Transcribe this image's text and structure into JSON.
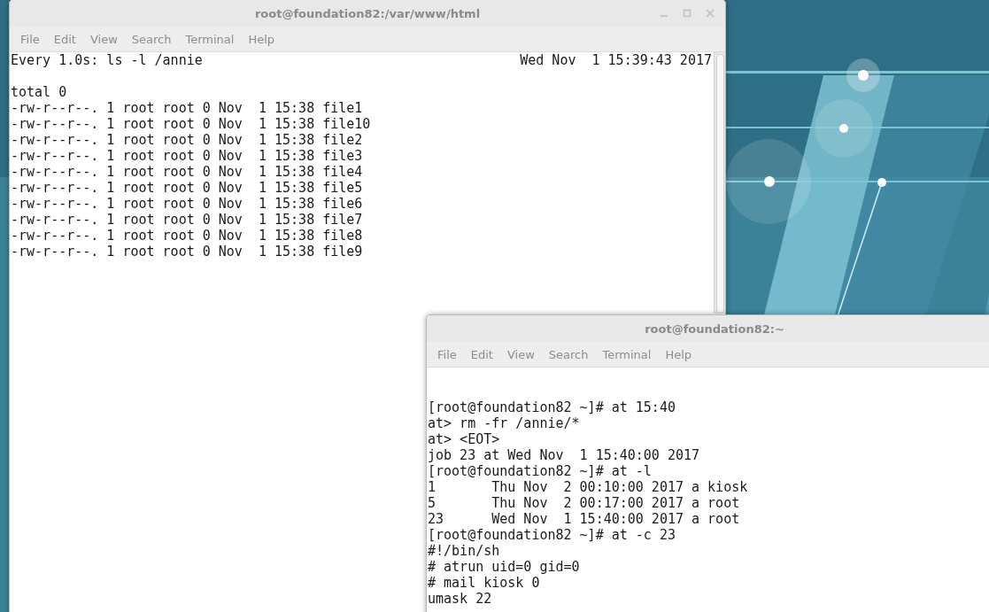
{
  "windows": [
    {
      "title": "root@foundation82:/var/www/html",
      "menu": [
        "File",
        "Edit",
        "View",
        "Search",
        "Terminal",
        "Help"
      ],
      "header": {
        "command": "Every 1.0s: ls -l /annie",
        "timestamp": "Wed Nov  1 15:39:43 2017"
      },
      "lines": [
        "total 0",
        "-rw-r--r--. 1 root root 0 Nov  1 15:38 file1",
        "-rw-r--r--. 1 root root 0 Nov  1 15:38 file10",
        "-rw-r--r--. 1 root root 0 Nov  1 15:38 file2",
        "-rw-r--r--. 1 root root 0 Nov  1 15:38 file3",
        "-rw-r--r--. 1 root root 0 Nov  1 15:38 file4",
        "-rw-r--r--. 1 root root 0 Nov  1 15:38 file5",
        "-rw-r--r--. 1 root root 0 Nov  1 15:38 file6",
        "-rw-r--r--. 1 root root 0 Nov  1 15:38 file7",
        "-rw-r--r--. 1 root root 0 Nov  1 15:38 file8",
        "-rw-r--r--. 1 root root 0 Nov  1 15:38 file9"
      ]
    },
    {
      "title": "root@foundation82:~",
      "menu": [
        "File",
        "Edit",
        "View",
        "Search",
        "Terminal",
        "Help"
      ],
      "lines": [
        "[root@foundation82 ~]# at 15:40",
        "at> rm -fr /annie/*",
        "at> <EOT>",
        "job 23 at Wed Nov  1 15:40:00 2017",
        "[root@foundation82 ~]# at -l",
        "1       Thu Nov  2 00:10:00 2017 a kiosk",
        "5       Thu Nov  2 00:17:00 2017 a root",
        "23      Wed Nov  1 15:40:00 2017 a root",
        "[root@foundation82 ~]# at -c 23",
        "#!/bin/sh",
        "# atrun uid=0 gid=0",
        "# mail kiosk 0",
        "umask 22"
      ]
    }
  ]
}
